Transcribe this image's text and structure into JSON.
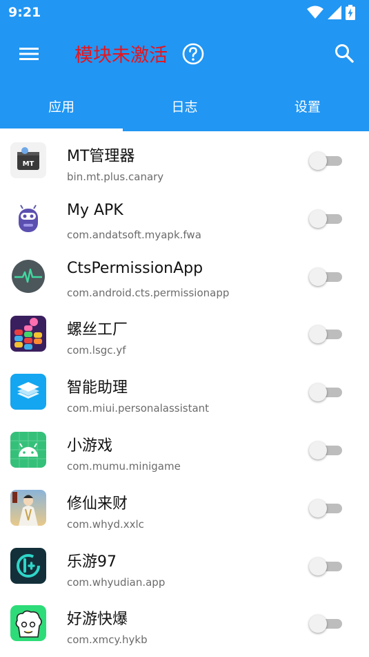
{
  "status_bar": {
    "time": "9:21",
    "icons": [
      "wifi-icon",
      "signal-icon",
      "battery-charging-icon"
    ]
  },
  "toolbar": {
    "title": "模块未激活",
    "title_color": "#e8141c",
    "menu_icon": "hamburger-menu-icon",
    "help_icon": "help-circle-icon",
    "search_icon": "search-icon"
  },
  "colors": {
    "primary": "#2196f3",
    "switch_off_track": "#bdbdbd",
    "switch_off_thumb": "#f1f1f1"
  },
  "tabs": [
    {
      "label": "应用",
      "active": true
    },
    {
      "label": "日志",
      "active": false
    },
    {
      "label": "设置",
      "active": false
    }
  ],
  "apps": [
    {
      "name": "MT管理器",
      "package": "bin.mt.plus.canary",
      "enabled": false
    },
    {
      "name": "My APK",
      "package": "com.andatsoft.myapk.fwa",
      "enabled": false
    },
    {
      "name": "CtsPermissionApp",
      "package": "com.android.cts.permissionapp",
      "enabled": false
    },
    {
      "name": "螺丝工厂",
      "package": "com.lsgc.yf",
      "enabled": false
    },
    {
      "name": "智能助理",
      "package": "com.miui.personalassistant",
      "enabled": false
    },
    {
      "name": "小游戏",
      "package": "com.mumu.minigame",
      "enabled": false
    },
    {
      "name": "修仙来财",
      "package": "com.whyd.xxlc",
      "enabled": false
    },
    {
      "name": "乐游97",
      "package": "com.whyudian.app",
      "enabled": false
    },
    {
      "name": "好游快爆",
      "package": "com.xmcy.hykb",
      "enabled": false
    }
  ]
}
